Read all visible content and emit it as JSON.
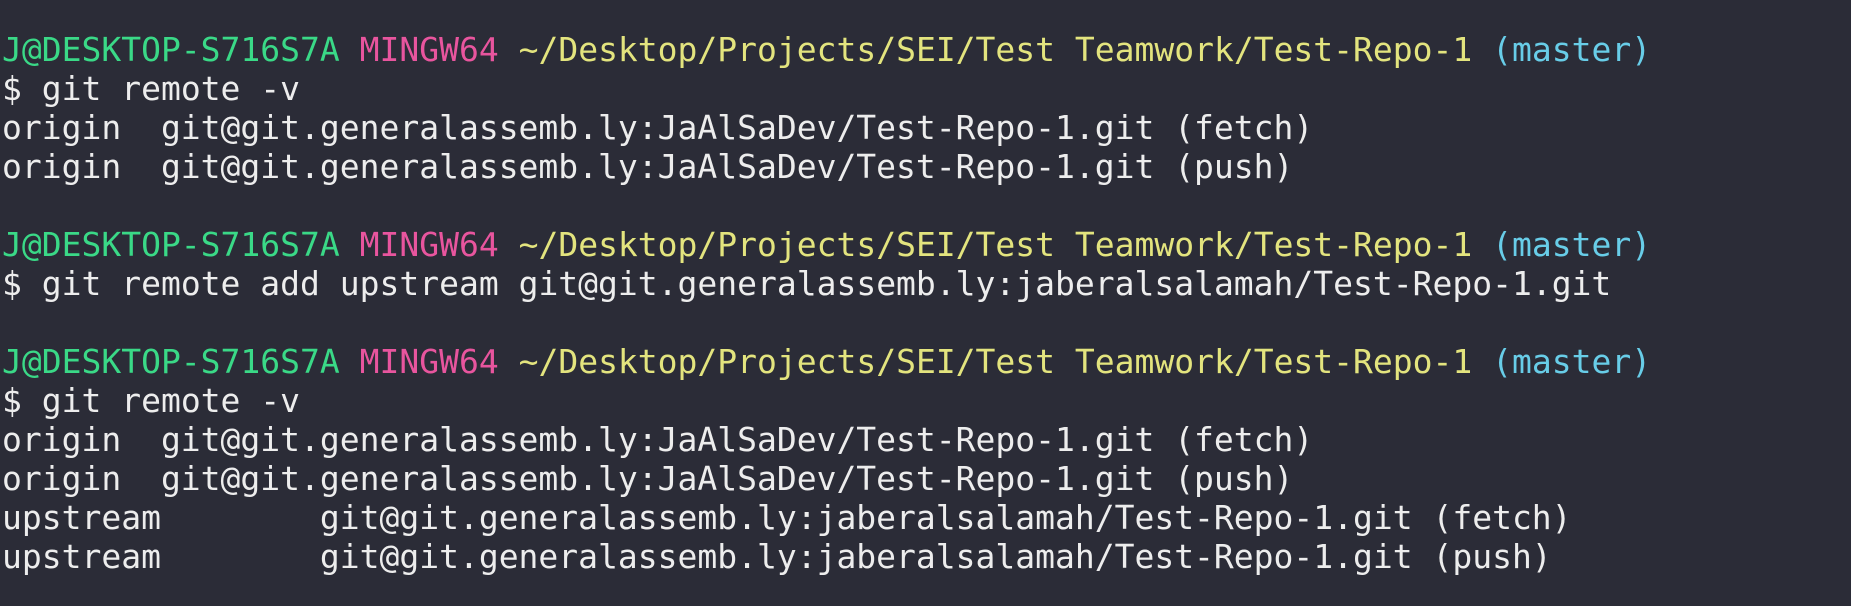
{
  "colors": {
    "background": "#2b2c37",
    "user_host": "#3ad987",
    "system": "#e8559e",
    "path": "#e3e47e",
    "branch": "#68cde8",
    "text": "#ededed"
  },
  "prompt": {
    "user_host": "J@DESKTOP-S716S7A",
    "system": "MINGW64",
    "path": "~/Desktop/Projects/SEI/Test Teamwork/Test-Repo-1",
    "branch": "(master)",
    "symbol": "$"
  },
  "blocks": [
    {
      "command": "git remote -v",
      "output": [
        "origin  git@git.generalassemb.ly:JaAlSaDev/Test-Repo-1.git (fetch)",
        "origin  git@git.generalassemb.ly:JaAlSaDev/Test-Repo-1.git (push)"
      ]
    },
    {
      "command": "git remote add upstream git@git.generalassemb.ly:jaberalsalamah/Test-Repo-1.git",
      "output": []
    },
    {
      "command": "git remote -v",
      "output": [
        "origin  git@git.generalassemb.ly:JaAlSaDev/Test-Repo-1.git (fetch)",
        "origin  git@git.generalassemb.ly:JaAlSaDev/Test-Repo-1.git (push)",
        "upstream        git@git.generalassemb.ly:jaberalsalamah/Test-Repo-1.git (fetch)",
        "upstream        git@git.generalassemb.ly:jaberalsalamah/Test-Repo-1.git (push)"
      ]
    }
  ]
}
